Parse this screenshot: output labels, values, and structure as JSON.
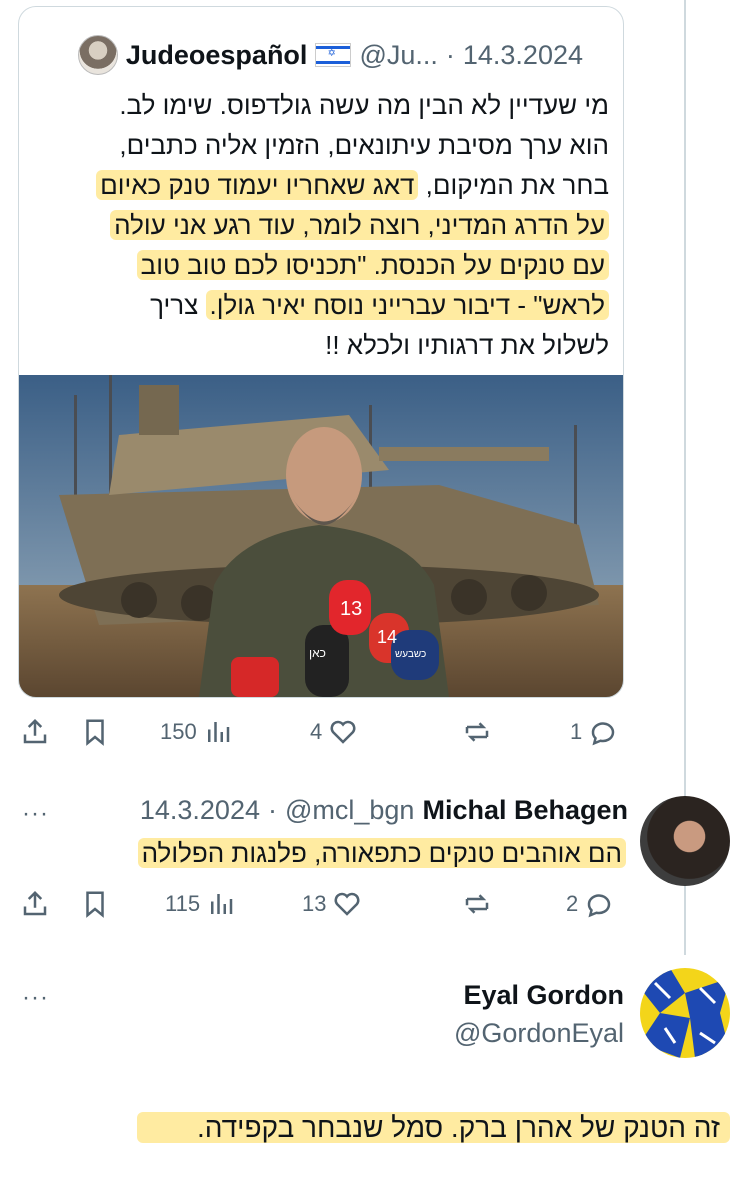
{
  "quoted": {
    "name": "Judeoespañol",
    "flag": "🇮🇱",
    "handle": "@Ju...",
    "separator": "·",
    "date": "14.3.2024",
    "lines": [
      "מי שעדיין לא הבין מה עשה גולדפוס. שימו לב.",
      "הוא ערך מסיבת עיתונאים, הזמין אליה כתבים,",
      "בחר את המיקום, ",
      "דאג שאחריו יעמוד טנק כאיום",
      "על הדרג המדיני, רוצה לומר, עוד רגע אני עולה",
      "עם טנקים על הכנסת. \"תכניסו לכם טוב טוב",
      "לראש\" - דיבור עברייני נוסח יאיר גולן.",
      "  צריך",
      "לשלול את דרגותיו ולכלא !!"
    ],
    "photo_alt": "soldier-at-microphones-in-front-of-tank",
    "mic_labels": [
      "13",
      "14",
      "כאן",
      "כשבעש"
    ],
    "stats": {
      "replies": "1",
      "reposts": "",
      "likes": "4",
      "views": "150"
    }
  },
  "reply1": {
    "name": "Michal Behagen",
    "handle": "@mcl_bgn",
    "separator": "·",
    "date": "14.3.2024",
    "more": "···",
    "text": "הם אוהבים טנקים כתפאורה, פלנגות הפלולה",
    "stats": {
      "replies": "2",
      "likes": "13",
      "views": "115"
    }
  },
  "reply2": {
    "name": "Eyal Gordon",
    "handle": "@GordonEyal",
    "more": "···",
    "text": "זה הטנק של אהרן ברק. סמל שנבחר בקפידה."
  },
  "colors": {
    "highlight": "#ffe06e",
    "muted": "#536471",
    "text": "#0f1419",
    "border": "#cfd9de"
  },
  "icons": [
    "share-icon",
    "bookmark-icon",
    "views-icon",
    "heart-icon",
    "repost-icon",
    "reply-icon",
    "more-icon"
  ]
}
